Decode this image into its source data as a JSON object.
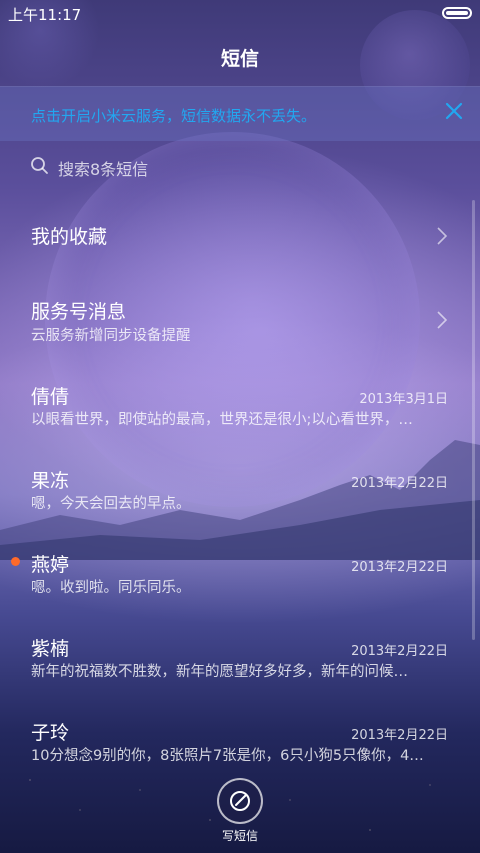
{
  "status_bar": {
    "time": "上午11:17",
    "battery_icon": "battery-full-icon"
  },
  "header": {
    "title": "短信"
  },
  "banner": {
    "text": "点击开启小米云服务，短信数据永不丢失。",
    "text_color": "#22a7f0",
    "close_icon": "close-icon"
  },
  "search": {
    "placeholder": "搜索8条短信",
    "icon": "search-icon"
  },
  "favorites": {
    "label": "我的收藏",
    "icon": "chevron-right-icon"
  },
  "service": {
    "label": "服务号消息",
    "subtitle": "云服务新增同步设备提醒",
    "icon": "chevron-right-icon"
  },
  "conversations": [
    {
      "name": "倩倩",
      "date": "2013年3月1日",
      "preview": "以眼看世界，即使站的最高，世界还是很小;以心看世界，…",
      "unread": false
    },
    {
      "name": "果冻",
      "date": "2013年2月22日",
      "preview": "嗯，今天会回去的早点。",
      "unread": false
    },
    {
      "name": "燕婷",
      "date": "2013年2月22日",
      "preview": "嗯。收到啦。同乐同乐。",
      "unread": true
    },
    {
      "name": "紫楠",
      "date": "2013年2月22日",
      "preview": "新年的祝福数不胜数，新年的愿望好多好多，新年的问候…",
      "unread": false
    },
    {
      "name": "子玲",
      "date": "2013年2月22日",
      "preview": "10分想念9别的你，8张照片7张是你，6只小狗5只像你，4…",
      "unread": false
    }
  ],
  "compose": {
    "label": "写短信",
    "icon": "compose-icon"
  },
  "colors": {
    "unread_dot": "#ff6a2a",
    "accent": "#22a7f0"
  }
}
